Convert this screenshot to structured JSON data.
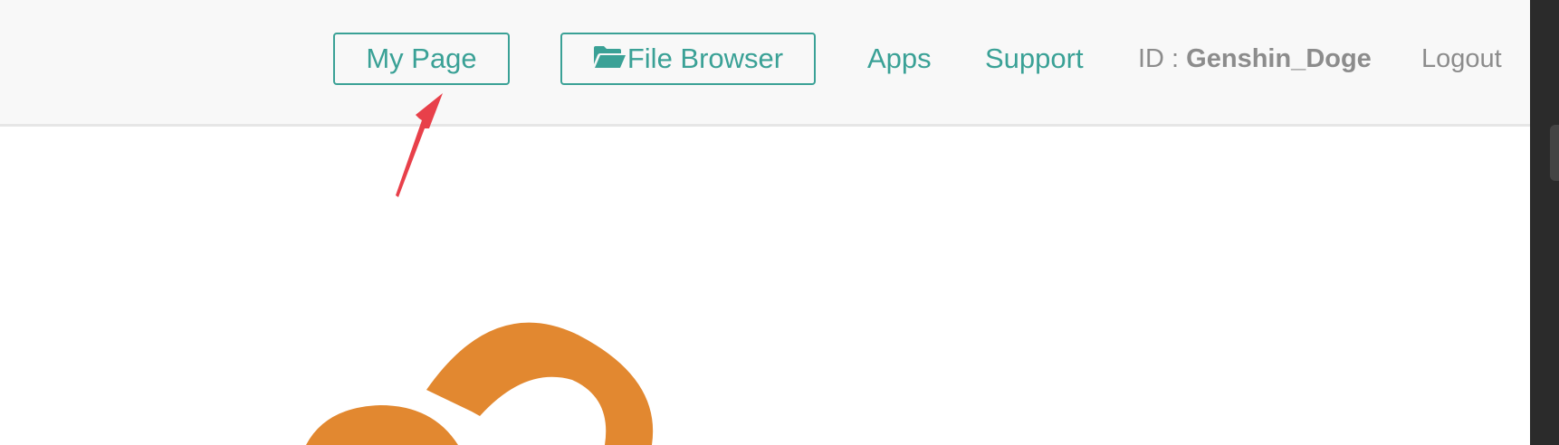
{
  "header": {
    "my_page_label": "My Page",
    "file_browser_label": "File Browser",
    "apps_label": "Apps",
    "support_label": "Support",
    "id_prefix": "ID : ",
    "username": "Genshin_Doge",
    "logout_label": "Logout"
  },
  "icons": {
    "file_browser": "folder-open-icon",
    "annotation": "red-arrow-icon",
    "logo": "cloud-logo"
  },
  "colors": {
    "accent": "#3aa196",
    "muted_text": "#8c8c8c",
    "annotation_arrow": "#e8404a",
    "logo": "#e28830",
    "header_bg": "#f8f8f8"
  }
}
